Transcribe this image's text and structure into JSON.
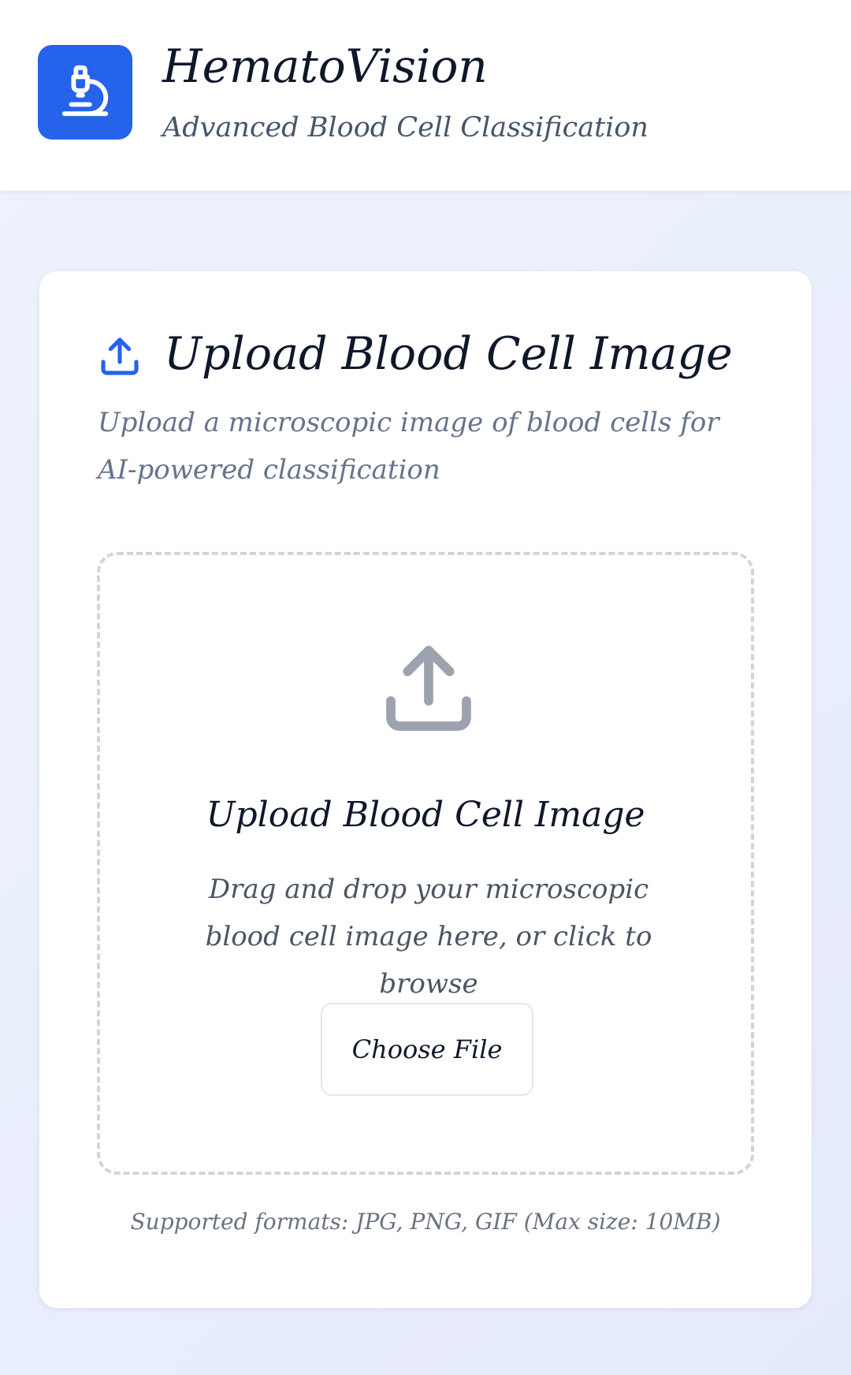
{
  "header": {
    "logo_icon": "microscope-icon",
    "title": "HematoVision",
    "subtitle": "Advanced Blood Cell Classification"
  },
  "upload_card": {
    "header_icon": "upload-icon",
    "title": "Upload Blood Cell Image",
    "description": "Upload a microscopic image of blood cells for AI-powered classification",
    "dropzone": {
      "icon": "upload-icon",
      "title": "Upload Blood Cell Image",
      "description": "Drag and drop your microscopic blood cell image here, or click to browse",
      "button_label": "Choose File"
    },
    "formats_note": "Supported formats: JPG, PNG, GIF (Max size: 10MB)"
  },
  "colors": {
    "brand": "#2563eb",
    "dropzone_border": "#d1d5db",
    "upload_icon_muted": "#9ca3af"
  }
}
